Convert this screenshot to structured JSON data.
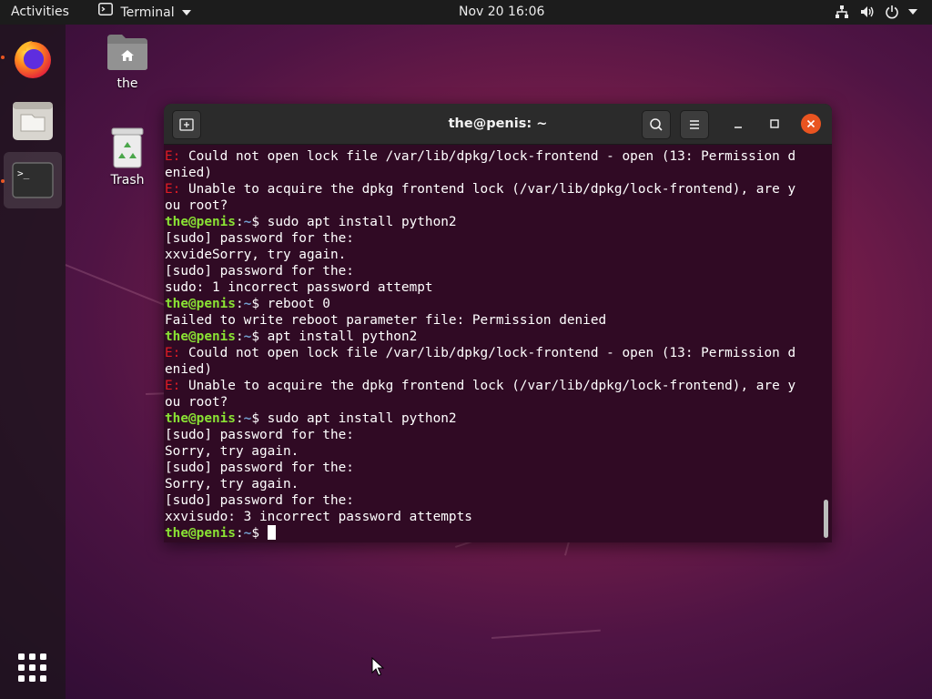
{
  "topbar": {
    "activities": "Activities",
    "app_name": "Terminal",
    "clock": "Nov 20  16:06"
  },
  "desktop": {
    "home_label": "the",
    "trash_label": "Trash"
  },
  "terminal": {
    "title": "the@penis: ~",
    "prompt_user": "the@penis",
    "prompt_colon": ":",
    "prompt_path": "~",
    "prompt_dollar": "$ ",
    "error_prefix": "E:",
    "lines": [
      {
        "type": "error",
        "text": " Could not open lock file /var/lib/dpkg/lock-frontend - open (13: Permission d"
      },
      {
        "type": "out",
        "text": "enied)"
      },
      {
        "type": "error",
        "text": " Unable to acquire the dpkg frontend lock (/var/lib/dpkg/lock-frontend), are y"
      },
      {
        "type": "out",
        "text": "ou root?"
      },
      {
        "type": "prompt",
        "text": "sudo apt install python2"
      },
      {
        "type": "out",
        "text": "[sudo] password for the:"
      },
      {
        "type": "out",
        "text": "xxvideSorry, try again."
      },
      {
        "type": "out",
        "text": "[sudo] password for the:"
      },
      {
        "type": "out",
        "text": "sudo: 1 incorrect password attempt"
      },
      {
        "type": "prompt",
        "text": "reboot 0"
      },
      {
        "type": "out",
        "text": "Failed to write reboot parameter file: Permission denied"
      },
      {
        "type": "prompt",
        "text": "apt install python2"
      },
      {
        "type": "error",
        "text": " Could not open lock file /var/lib/dpkg/lock-frontend - open (13: Permission d"
      },
      {
        "type": "out",
        "text": "enied)"
      },
      {
        "type": "error",
        "text": " Unable to acquire the dpkg frontend lock (/var/lib/dpkg/lock-frontend), are y"
      },
      {
        "type": "out",
        "text": "ou root?"
      },
      {
        "type": "prompt",
        "text": "sudo apt install python2"
      },
      {
        "type": "out",
        "text": "[sudo] password for the:"
      },
      {
        "type": "out",
        "text": "Sorry, try again."
      },
      {
        "type": "out",
        "text": "[sudo] password for the:"
      },
      {
        "type": "out",
        "text": "Sorry, try again."
      },
      {
        "type": "out",
        "text": "[sudo] password for the:"
      },
      {
        "type": "out",
        "text": "xxvisudo: 3 incorrect password attempts"
      },
      {
        "type": "prompt",
        "text": ""
      }
    ]
  },
  "colors": {
    "terminal_bg": "#300a24",
    "prompt_user": "#8ae234",
    "prompt_path": "#729fcf",
    "error": "#e01b24",
    "accent": "#e95420"
  },
  "icons": {
    "topbar_app": "terminal-icon",
    "network": "network-icon",
    "volume": "volume-icon",
    "power": "power-icon",
    "dock": [
      "firefox-icon",
      "files-icon",
      "terminal-icon",
      "app-grid-icon"
    ],
    "header": [
      "new-tab-icon",
      "search-icon",
      "menu-icon",
      "minimize-icon",
      "maximize-icon",
      "close-icon"
    ]
  }
}
